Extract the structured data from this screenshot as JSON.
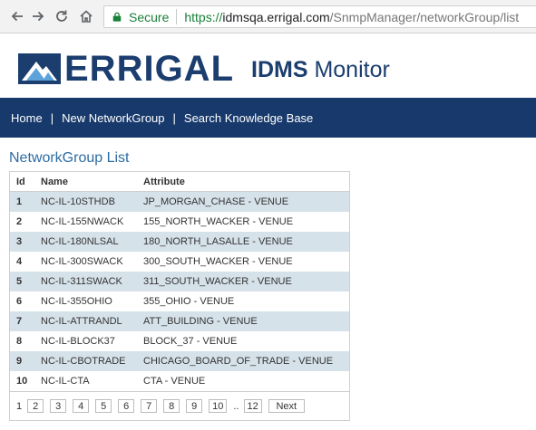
{
  "browser": {
    "secure_label": "Secure",
    "url_scheme": "https://",
    "url_domain": "idmsqa.errigal.com",
    "url_path": "/SnmpManager/networkGroup/list"
  },
  "header": {
    "logo_text": "ERRIGAL",
    "product_bold": "IDMS",
    "product_rest": " Monitor"
  },
  "nav": {
    "items": [
      {
        "label": "Home"
      },
      {
        "label": "New NetworkGroup"
      },
      {
        "label": "Search Knowledge Base"
      }
    ],
    "divider": "|"
  },
  "page_title": "NetworkGroup List",
  "table": {
    "columns": [
      "Id",
      "Name",
      "Attribute"
    ],
    "rows": [
      {
        "id": "1",
        "name": "NC-IL-10STHDB",
        "attribute": "JP_MORGAN_CHASE - VENUE"
      },
      {
        "id": "2",
        "name": "NC-IL-155NWACK",
        "attribute": "155_NORTH_WACKER - VENUE"
      },
      {
        "id": "3",
        "name": "NC-IL-180NLSAL",
        "attribute": "180_NORTH_LASALLE - VENUE"
      },
      {
        "id": "4",
        "name": "NC-IL-300SWACK",
        "attribute": "300_SOUTH_WACKER - VENUE"
      },
      {
        "id": "5",
        "name": "NC-IL-311SWACK",
        "attribute": "311_SOUTH_WACKER - VENUE"
      },
      {
        "id": "6",
        "name": "NC-IL-355OHIO",
        "attribute": "355_OHIO - VENUE"
      },
      {
        "id": "7",
        "name": "NC-IL-ATTRANDL",
        "attribute": "ATT_BUILDING - VENUE"
      },
      {
        "id": "8",
        "name": "NC-IL-BLOCK37",
        "attribute": "BLOCK_37 - VENUE"
      },
      {
        "id": "9",
        "name": "NC-IL-CBOTRADE",
        "attribute": "CHICAGO_BOARD_OF_TRADE - VENUE"
      },
      {
        "id": "10",
        "name": "NC-IL-CTA",
        "attribute": "CTA - VENUE"
      }
    ]
  },
  "pagination": {
    "current": "1",
    "pages": [
      "2",
      "3",
      "4",
      "5",
      "6",
      "7",
      "8",
      "9",
      "10"
    ],
    "ellipsis": "..",
    "last": "12",
    "next_label": "Next"
  },
  "colors": {
    "navbar": "#17396b",
    "brand": "#1b3e6f",
    "title": "#2d6ca2",
    "row_stripe": "#d6e2ea",
    "secure_green": "#188038"
  },
  "icons": [
    "back-arrow-icon",
    "forward-arrow-icon",
    "reload-icon",
    "home-icon",
    "lock-icon",
    "mountain-logo-icon"
  ]
}
